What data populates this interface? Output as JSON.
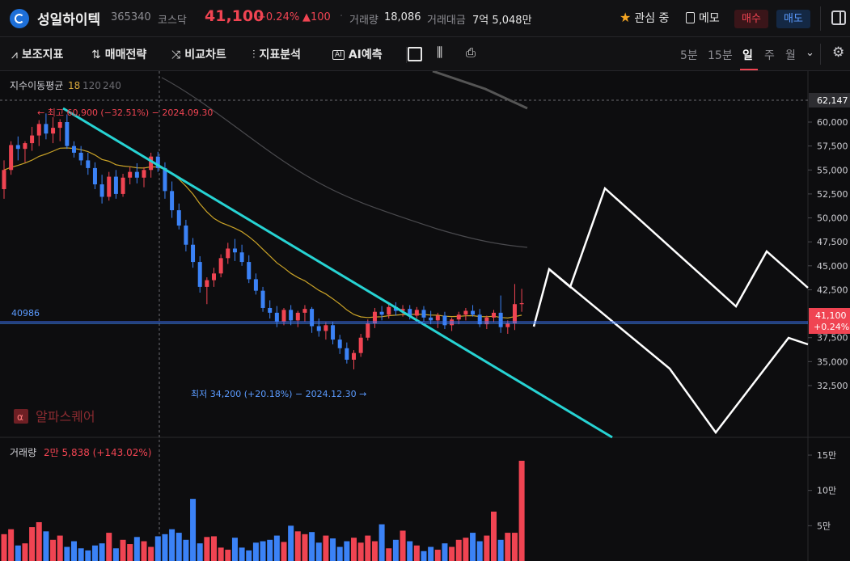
{
  "header": {
    "stock_name": "성일하이텍",
    "stock_code": "365340",
    "market": "코스닥",
    "price": "41,100",
    "change_pct": "+0.24%",
    "change_amt": "▲100",
    "volume_label": "거래량",
    "volume_value": "18,086",
    "amount_label": "거래대금",
    "amount_value": "7억 5,048만",
    "favorite_label": "관심 중",
    "memo_label": "메모",
    "buy_label": "매수",
    "sell_label": "매도"
  },
  "toolbar": {
    "indicators": "보조지표",
    "strategy": "매매전략",
    "compare": "비교차트",
    "analysis": "지표분석",
    "ai_predict": "AI예측",
    "periods": [
      "5분",
      "15분",
      "일",
      "주",
      "월"
    ],
    "active_period": "일"
  },
  "chart_data": {
    "type": "candlestick",
    "ma_legend": {
      "label": "지수이동평균",
      "periods": [
        "18",
        "120",
        "240"
      ]
    },
    "high_annotation": "← 최고 60,900 (−32.51%) − 2024.09.30",
    "low_annotation": "최저 34,200 (+20.18%) − 2024.12.30 →",
    "reference_line_label": "40986",
    "crosshair_value": "62,147",
    "current_price_tag": [
      "41,100",
      "+0.24%"
    ],
    "y_axis_ticks": [
      "60,000",
      "57,500",
      "55,000",
      "52,500",
      "50,000",
      "47,500",
      "45,000",
      "42,500",
      "37,500",
      "35,000",
      "32,500"
    ],
    "ylim": [
      30000,
      63000
    ],
    "watermark": "알파스퀘어",
    "volume_panel": {
      "label": "거래량",
      "value": "2만 5,838 (+143.02%)",
      "y_axis_ticks": [
        "15만",
        "10만",
        "5만"
      ],
      "ylim": [
        0,
        160000
      ]
    },
    "colors": {
      "up": "#f04452",
      "down": "#3b82f6",
      "ma18": "#c9a227",
      "ma120": "#555555",
      "trendline": "#27d3d3",
      "drawing": "#ffffff"
    },
    "candles": [
      [
        53000,
        56000,
        52000,
        55000
      ],
      [
        55000,
        58000,
        54500,
        57600
      ],
      [
        57600,
        58500,
        56000,
        57200
      ],
      [
        57200,
        58000,
        55800,
        57800
      ],
      [
        57800,
        59500,
        57000,
        58600
      ],
      [
        58600,
        60200,
        57500,
        59800
      ],
      [
        59800,
        60900,
        58200,
        58800
      ],
      [
        58800,
        60500,
        57800,
        59400
      ],
      [
        59400,
        60300,
        58000,
        60000
      ],
      [
        60000,
        60800,
        57200,
        57500
      ],
      [
        57500,
        58000,
        56300,
        56800
      ],
      [
        56800,
        57500,
        55500,
        56000
      ],
      [
        56000,
        56800,
        54500,
        55200
      ],
      [
        55200,
        55800,
        53000,
        53500
      ],
      [
        53500,
        54500,
        51500,
        52200
      ],
      [
        52200,
        54800,
        51800,
        54300
      ],
      [
        54300,
        55000,
        52000,
        52500
      ],
      [
        52500,
        54600,
        52200,
        54200
      ],
      [
        54200,
        55300,
        53500,
        54800
      ],
      [
        54800,
        55700,
        53600,
        54200
      ],
      [
        54200,
        55300,
        53200,
        55000
      ],
      [
        55000,
        56800,
        54200,
        56400
      ],
      [
        56400,
        56900,
        54800,
        55200
      ],
      [
        55200,
        55800,
        52000,
        52800
      ],
      [
        52800,
        53800,
        50000,
        50800
      ],
      [
        50800,
        51500,
        48800,
        49200
      ],
      [
        49200,
        49800,
        46500,
        47200
      ],
      [
        47200,
        47900,
        44800,
        45400
      ],
      [
        45400,
        46000,
        42200,
        42800
      ],
      [
        42800,
        43800,
        41000,
        43500
      ],
      [
        43500,
        44800,
        42800,
        44200
      ],
      [
        44200,
        46200,
        43800,
        45800
      ],
      [
        45800,
        47400,
        45200,
        46800
      ],
      [
        46800,
        47800,
        45500,
        46400
      ],
      [
        46400,
        47200,
        45000,
        45400
      ],
      [
        45400,
        46100,
        43200,
        43600
      ],
      [
        43600,
        44200,
        42000,
        42400
      ],
      [
        42400,
        42800,
        40200,
        40600
      ],
      [
        40600,
        41400,
        39500,
        40100
      ],
      [
        40100,
        40800,
        38600,
        39200
      ],
      [
        39200,
        40600,
        38800,
        40400
      ],
      [
        40400,
        40900,
        38800,
        39300
      ],
      [
        39300,
        40300,
        38600,
        40100
      ],
      [
        40100,
        40900,
        39200,
        40500
      ],
      [
        40500,
        40700,
        38000,
        38700
      ],
      [
        38700,
        39500,
        37600,
        38200
      ],
      [
        38200,
        39100,
        37300,
        38800
      ],
      [
        38800,
        39200,
        36800,
        37300
      ],
      [
        37300,
        37800,
        35800,
        36400
      ],
      [
        36400,
        37000,
        34800,
        35200
      ],
      [
        35200,
        36200,
        34200,
        35900
      ],
      [
        35900,
        37900,
        35500,
        37500
      ],
      [
        37500,
        39400,
        37200,
        39000
      ],
      [
        39000,
        40600,
        38500,
        40200
      ],
      [
        40200,
        40800,
        39300,
        39900
      ],
      [
        39900,
        41100,
        39500,
        40700
      ],
      [
        40700,
        41200,
        39800,
        40300
      ],
      [
        40300,
        40900,
        39700,
        40500
      ],
      [
        40500,
        40900,
        39400,
        39800
      ],
      [
        39800,
        40700,
        39500,
        40400
      ],
      [
        40400,
        40800,
        39200,
        39600
      ],
      [
        39600,
        40300,
        38900,
        39300
      ],
      [
        39300,
        40100,
        38500,
        39800
      ],
      [
        39800,
        40200,
        38400,
        38800
      ],
      [
        38800,
        39600,
        38200,
        39400
      ],
      [
        39400,
        40200,
        38900,
        39900
      ],
      [
        39900,
        40600,
        39300,
        40300
      ],
      [
        40300,
        40900,
        39700,
        39900
      ],
      [
        39900,
        40500,
        38600,
        38900
      ],
      [
        38900,
        39800,
        38400,
        39600
      ],
      [
        39600,
        40400,
        39100,
        40100
      ],
      [
        40100,
        41900,
        38000,
        38600
      ],
      [
        38600,
        39300,
        37900,
        39000
      ],
      [
        39000,
        43100,
        38300,
        41000
      ],
      [
        41000,
        42600,
        40200,
        41100
      ]
    ],
    "volumes": [
      38000,
      45000,
      22000,
      25000,
      48000,
      55000,
      42000,
      30000,
      36000,
      20000,
      28000,
      18000,
      15000,
      22000,
      25000,
      40000,
      18000,
      30000,
      24000,
      34000,
      28000,
      20000,
      35000,
      38000,
      45000,
      40000,
      30000,
      88000,
      25000,
      34000,
      35000,
      19000,
      16000,
      33000,
      19000,
      15000,
      26000,
      28000,
      30000,
      36000,
      27000,
      50000,
      42000,
      38000,
      41000,
      26000,
      36000,
      32000,
      20000,
      28000,
      33000,
      26000,
      36000,
      28000,
      52000,
      18000,
      30000,
      43000,
      28000,
      22000,
      14000,
      20000,
      16000,
      25000,
      20000,
      30000,
      33000,
      40000,
      28000,
      36000,
      70000,
      30000,
      40000,
      40000,
      142000
    ]
  }
}
